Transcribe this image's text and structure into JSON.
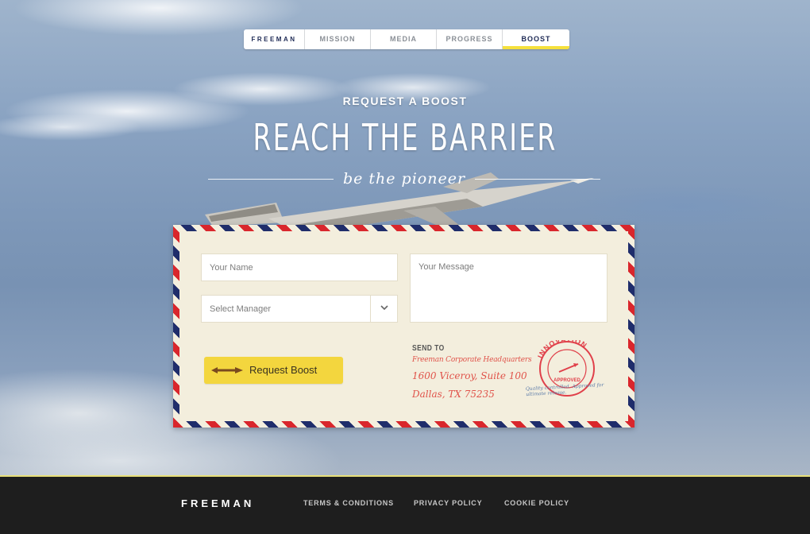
{
  "nav": {
    "brand": "FREEMAN",
    "items": [
      "MISSION",
      "MEDIA",
      "PROGRESS",
      "BOOST"
    ],
    "active": "BOOST"
  },
  "hero": {
    "kicker": "REQUEST A BOOST",
    "headline": "REACH THE BARRIER",
    "tagline": "be the pioneer"
  },
  "form": {
    "name_placeholder": "Your Name",
    "message_placeholder": "Your Message",
    "manager_select": "Select Manager",
    "submit_label": "Request Boost"
  },
  "address": {
    "label": "SEND TO",
    "line1": "Freeman Corporate Headquarters",
    "line2": "1600 Viceroy, Suite 100",
    "line3": "Dallas, TX 75235"
  },
  "stamp": {
    "top_text": "INNOVATION",
    "center_text": "APPROVED",
    "note": "Quality controlled. Approved for ultimate release."
  },
  "footer": {
    "brand": "FREEMAN",
    "links": [
      "TERMS & CONDITIONS",
      "PRIVACY POLICY",
      "COOKIE POLICY"
    ]
  },
  "colors": {
    "accent_yellow": "#f3d63e",
    "stripe_red": "#d9262c",
    "stripe_blue": "#1f2d6b",
    "envelope_paper": "#f3eedd",
    "footer_bg": "#1e1e1e"
  }
}
